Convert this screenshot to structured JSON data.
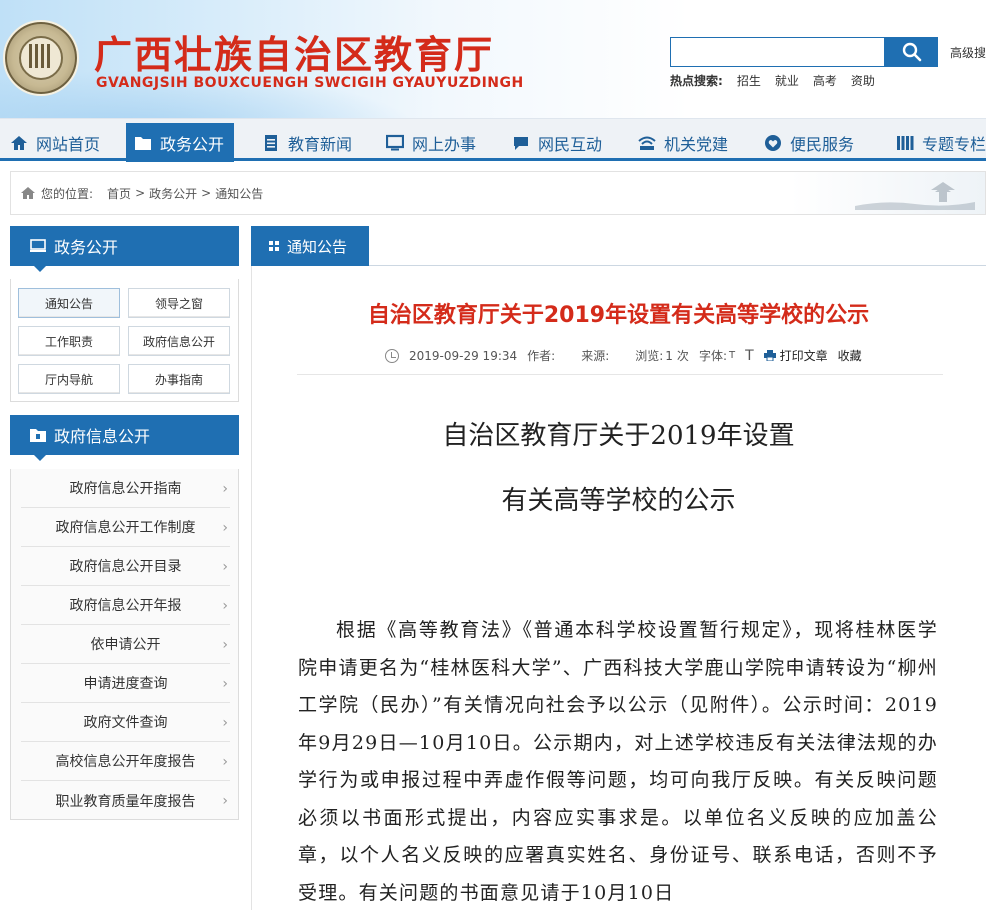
{
  "header": {
    "title": "广西壮族自治区教育厅",
    "subtitle": "GVANGJSIH BOUXCUENGH SWCIGIH GYAUYUZDINGH",
    "search_placeholder": "",
    "advanced_search": "高级搜",
    "hot_label": "热点搜索:",
    "hot_items": [
      "招生",
      "就业",
      "高考",
      "资助"
    ]
  },
  "nav": {
    "items": [
      {
        "label": "网站首页",
        "icon": "home-icon"
      },
      {
        "label": "政务公开",
        "icon": "folder-icon"
      },
      {
        "label": "教育新闻",
        "icon": "document-icon"
      },
      {
        "label": "网上办事",
        "icon": "monitor-icon"
      },
      {
        "label": "网民互动",
        "icon": "chat-icon"
      },
      {
        "label": "机关党建",
        "icon": "wifi-icon"
      },
      {
        "label": "便民服务",
        "icon": "heart-icon"
      },
      {
        "label": "专题专栏",
        "icon": "piano-icon"
      }
    ],
    "active_index": 1
  },
  "breadcrumb": {
    "label": "您的位置:",
    "items": [
      "首页",
      "政务公开",
      "通知公告"
    ],
    "separator": ">"
  },
  "sidebar": {
    "section1_title": "政务公开",
    "section1_items": [
      "通知公告",
      "领导之窗",
      "工作职责",
      "政府信息公开",
      "厅内导航",
      "办事指南"
    ],
    "section2_title": "政府信息公开",
    "section2_items": [
      "政府信息公开指南",
      "政府信息公开工作制度",
      "政府信息公开目录",
      "政府信息公开年报",
      "依申请公开",
      "申请进度查询",
      "政府文件查询",
      "高校信息公开年度报告",
      "职业教育质量年度报告"
    ]
  },
  "main": {
    "tab_label": "通知公告",
    "article_title": "自治区教育厅关于2019年设置有关高等学校的公示",
    "meta": {
      "datetime": "2019-09-29 19:34",
      "author_label": "作者:",
      "source_label": "来源:",
      "views_label": "浏览:",
      "views_value": "1",
      "views_unit": "次",
      "font_label": "字体:",
      "font_small": "T",
      "font_large": "T",
      "print_label": "打印文章",
      "favorite_label": "收藏"
    },
    "doc_title_line1": "自治区教育厅关于2019年设置",
    "doc_title_line2": "有关高等学校的公示",
    "body_paragraph": "根据《高等教育法》《普通本科学校设置暂行规定》，现将桂林医学院申请更名为“桂林医科大学”、广西科技大学鹿山学院申请转设为“柳州工学院（民办）”有关情况向社会予以公示（见附件）。公示时间：2019年9月29日—10月10日。公示期内，对上述学校违反有关法律法规的办学行为或申报过程中弄虚作假等问题，均可向我厅反映。有关反映问题必须以书面形式提出，内容应实事求是。以单位名义反映的应加盖公章，以个人名义反映的应署真实姓名、身份证号、联系电话，否则不予受理。有关问题的书面意见请于10月10日"
  },
  "colors": {
    "brand_blue": "#1f6fb2",
    "title_red": "#d42b1a"
  }
}
